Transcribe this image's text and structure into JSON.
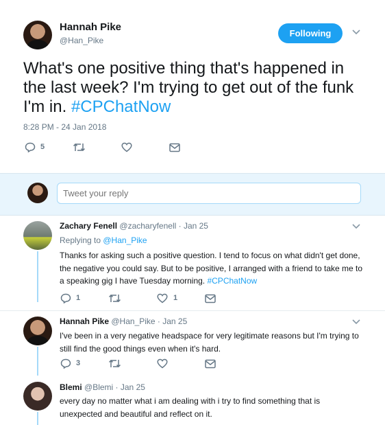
{
  "main_tweet": {
    "author_name": "Hannah Pike",
    "author_handle": "@Han_Pike",
    "follow_button": "Following",
    "text_main": "What's one positive thing that's happened in the last week? I'm trying to get out of the funk I'm in. ",
    "hashtag": "#CPChatNow",
    "timestamp": "8:28 PM - 24 Jan 2018",
    "reply_count": "5"
  },
  "reply_box": {
    "placeholder": "Tweet your reply"
  },
  "replies": [
    {
      "author_name": "Zachary Fenell",
      "meta": "@zacharyfenell · Jan 25",
      "replying_prefix": "Replying to ",
      "replying_to": "@Han_Pike",
      "text": "Thanks for asking such a positive question. I tend to focus on what didn't get done, the negative you could say. But to be positive, I arranged with a friend to take me to a speaking gig I have Tuesday morning. ",
      "hashtag": "#CPChatNow",
      "reply_count": "1",
      "like_count": "1"
    },
    {
      "author_name": "Hannah Pike",
      "meta": "@Han_Pike · Jan 25",
      "text": "I've been in a very negative headspace for very legitimate reasons but I'm trying to still find the good things even when it's hard.",
      "reply_count": "3"
    },
    {
      "author_name": "Blemi",
      "meta": "@Blemi · Jan 25",
      "text": "every day no matter what i am dealing with i try to find something that is unexpected and beautiful and reflect on it."
    }
  ],
  "colors": {
    "accent": "#1da1f2",
    "text": "#14171a",
    "muted": "#657786",
    "border": "#e6ecf0"
  }
}
